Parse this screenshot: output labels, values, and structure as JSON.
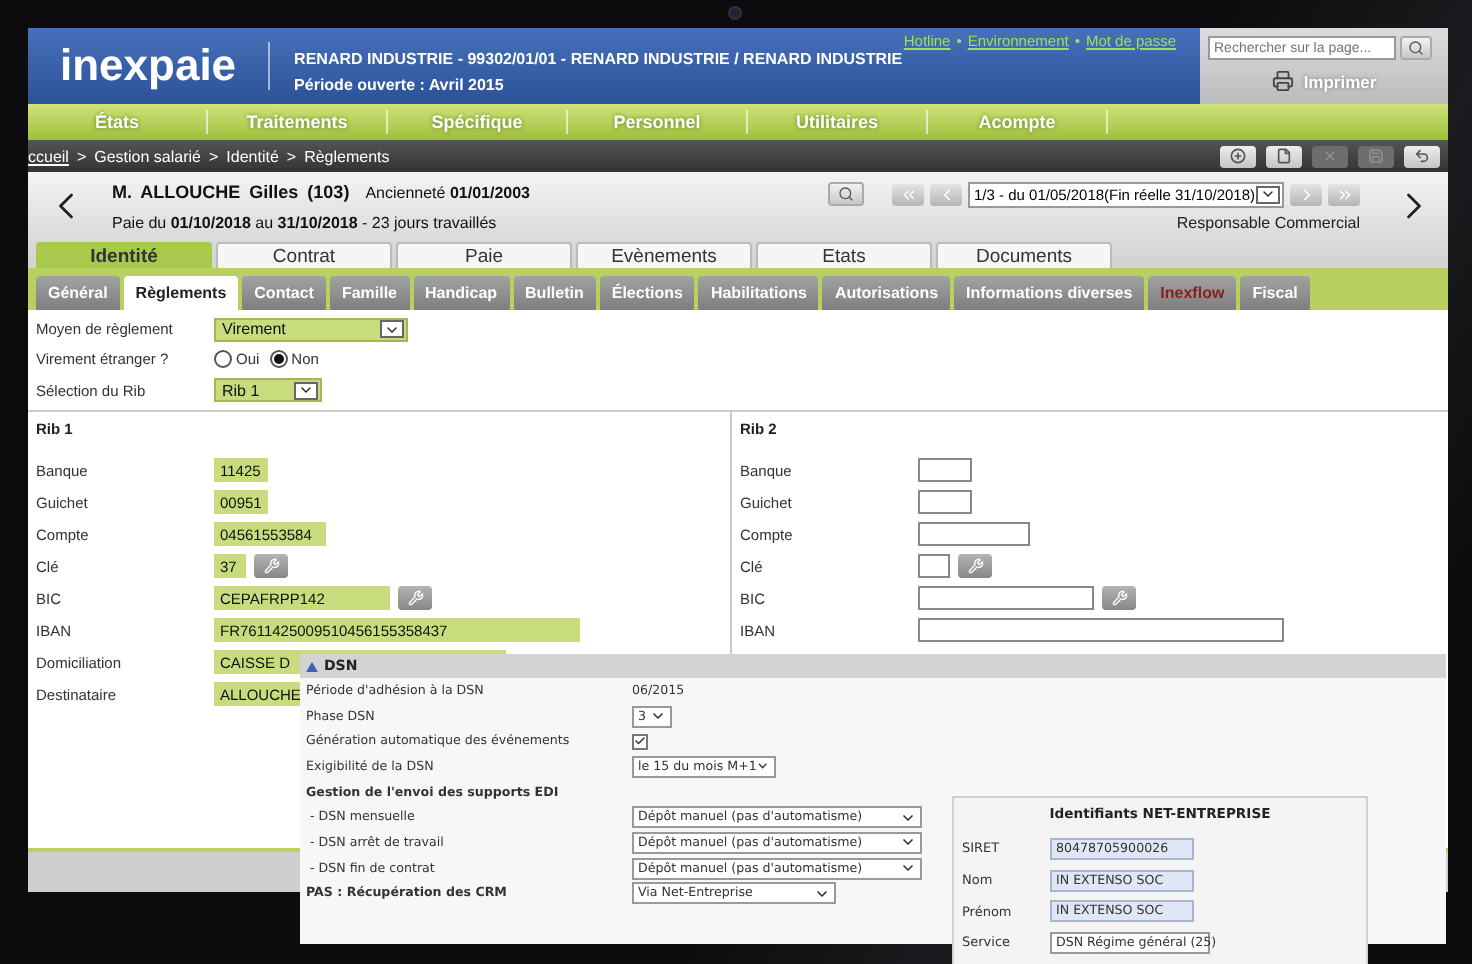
{
  "header": {
    "logo": "inexpaie",
    "company": "RENARD INDUSTRIE - 99302/01/01 - RENARD INDUSTRIE / RENARD INDUSTRIE",
    "period": "Période ouverte : Avril 2015",
    "links": [
      "Hotline",
      "Environnement",
      "Mot de passe"
    ],
    "link_separator": "•",
    "search": {
      "placeholder": "Rechercher sur la page..."
    },
    "print": "Imprimer"
  },
  "menu": [
    "États",
    "Traitements",
    "Spécifique",
    "Personnel",
    "Utilitaires",
    "Acompte"
  ],
  "breadcrumb": {
    "separator": ">",
    "items": [
      "ccueil",
      "Gestion salarié",
      "Identité",
      "Règlements"
    ]
  },
  "toolbar": [
    {
      "kind": "add",
      "disabled": false
    },
    {
      "kind": "document",
      "disabled": false
    },
    {
      "kind": "delete",
      "disabled": true
    },
    {
      "kind": "save",
      "disabled": true
    },
    {
      "kind": "undo",
      "disabled": false
    }
  ],
  "employee": {
    "name": "M. ALLOUCHE Gilles (103)",
    "seniority": "Ancienneté **01/01/2003**",
    "pay_period": "Paie du **01/10/2018** au **31/10/2018** - 23 jours travaillés",
    "period_select": "1/3 - du 01/05/2018(Fin réelle 31/10/2018)",
    "role": "Responsable Commercial"
  },
  "main_tabs": [
    {
      "label": "Identité",
      "selected": true
    },
    {
      "label": "Contrat",
      "selected": false
    },
    {
      "label": "Paie",
      "selected": false
    },
    {
      "label": "Evènements",
      "selected": false
    },
    {
      "label": "Etats",
      "selected": false
    },
    {
      "label": "Documents",
      "selected": false
    }
  ],
  "sub_tabs": [
    {
      "label": "Général",
      "selected": false,
      "highlighted": false
    },
    {
      "label": "Règlements",
      "selected": true,
      "highlighted": false
    },
    {
      "label": "Contact",
      "selected": false,
      "highlighted": false
    },
    {
      "label": "Famille",
      "selected": false,
      "highlighted": false
    },
    {
      "label": "Handicap",
      "selected": false,
      "highlighted": false
    },
    {
      "label": "Bulletin",
      "selected": false,
      "highlighted": false
    },
    {
      "label": "Élections",
      "selected": false,
      "highlighted": false
    },
    {
      "label": "Habilitations",
      "selected": false,
      "highlighted": false
    },
    {
      "label": "Autorisations",
      "selected": false,
      "highlighted": false
    },
    {
      "label": "Informations diverses",
      "selected": false,
      "highlighted": false
    },
    {
      "label": "Inexflow",
      "selected": false,
      "highlighted": true
    },
    {
      "label": "Fiscal",
      "selected": false,
      "highlighted": false
    }
  ],
  "payment": {
    "method_label": "Moyen de règlement",
    "method": "Virement",
    "foreign_label": "Virement étranger ?",
    "foreign_options": [
      {
        "label": "Oui",
        "selected": false
      },
      {
        "label": "Non",
        "selected": true
      }
    ],
    "rib_label": "Sélection du Rib",
    "rib": "Rib 1"
  },
  "ribs": [
    {
      "title": "Rib 1",
      "fields": [
        {
          "kind": "bank",
          "label": "Banque",
          "value": "11425"
        },
        {
          "kind": "bank",
          "label": "Guichet",
          "value": "00951"
        },
        {
          "kind": "account",
          "label": "Compte",
          "value": "04561553584"
        },
        {
          "kind": "key",
          "label": "Clé",
          "value": "37"
        },
        {
          "kind": "bic",
          "label": "BIC",
          "value": "CEPAFRPP142"
        },
        {
          "kind": "iban",
          "label": "IBAN",
          "value": "FR7611425009510456155358437"
        },
        {
          "kind": "address",
          "label": "Domiciliation",
          "value": "CAISSE D"
        },
        {
          "kind": "address",
          "label": "Destinataire",
          "value": "ALLOUCHE"
        }
      ]
    },
    {
      "title": "Rib 2",
      "fields": [
        {
          "kind": "bank",
          "label": "Banque"
        },
        {
          "kind": "bank",
          "label": "Guichet"
        },
        {
          "kind": "account",
          "label": "Compte"
        },
        {
          "kind": "key",
          "label": "Clé"
        },
        {
          "kind": "bic",
          "label": "BIC"
        },
        {
          "kind": "iban",
          "label": "IBAN"
        }
      ]
    }
  ],
  "dsn": {
    "title": "DSN",
    "rows": [
      {
        "kind": "text",
        "label": "Période d'adhésion à la DSN",
        "value": "06/2015"
      },
      {
        "kind": "select_small",
        "label": "Phase DSN",
        "value": "3"
      },
      {
        "kind": "checkbox",
        "label": "Génération automatique des événements",
        "checked": true
      },
      {
        "kind": "select_medium",
        "label": "Exigibilité de la DSN",
        "value": "le 15 du mois M+1"
      },
      {
        "kind": "heading",
        "label": "Gestion de l'envoi des supports EDI"
      },
      {
        "kind": "select_wide",
        "label": " - DSN mensuelle",
        "value": "Dépôt manuel (pas d'automatisme)"
      },
      {
        "kind": "select_wide",
        "label": " - DSN arrêt de travail",
        "value": "Dépôt manuel (pas d'automatisme)"
      },
      {
        "kind": "select_wide",
        "label": " - DSN fin de contrat",
        "value": "Dépôt manuel (pas d'automatisme)"
      },
      {
        "kind": "heading_select",
        "label": "PAS : Récupération des CRM",
        "value": "Via Net-Entreprise"
      }
    ],
    "identifiers": {
      "title": "Identifiants NET-ENTREPRISE",
      "fields": [
        {
          "kind": "input",
          "label": "SIRET",
          "value": "80478705900026"
        },
        {
          "kind": "input",
          "label": "Nom",
          "value": "IN EXTENSO SOC"
        },
        {
          "kind": "input",
          "label": "Prénom",
          "value": "IN EXTENSO SOC"
        },
        {
          "kind": "select",
          "label": "Service",
          "value": "DSN Régime général (25)"
        }
      ]
    }
  }
}
